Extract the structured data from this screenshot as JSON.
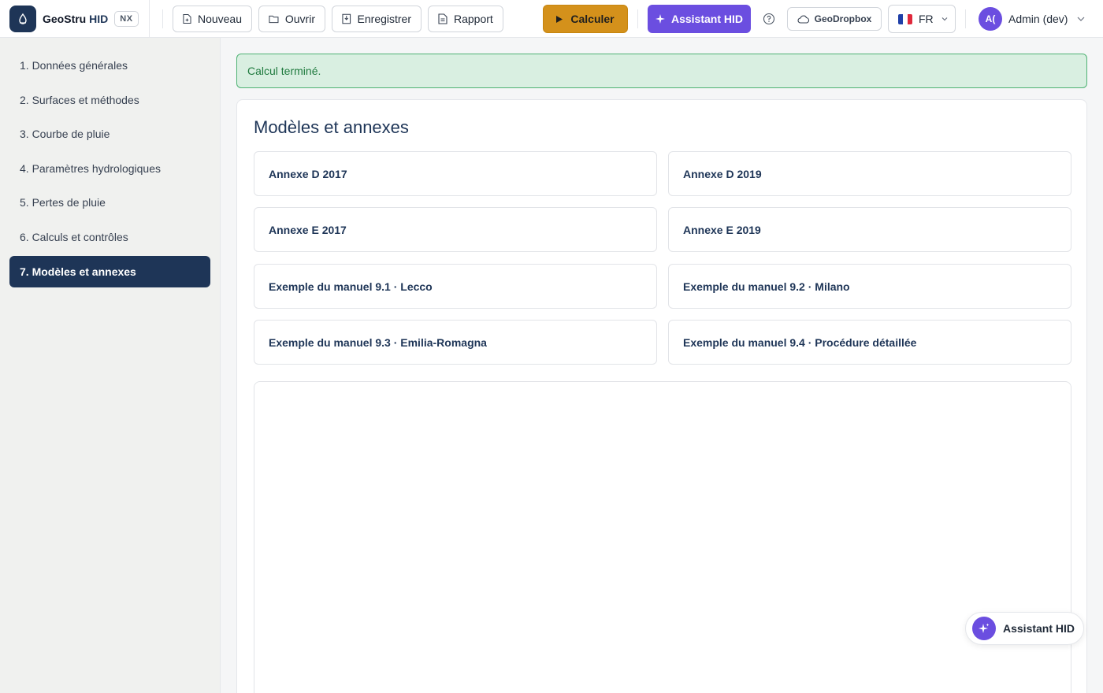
{
  "header": {
    "brand_prefix": "GeoStru",
    "brand_suffix": "HID",
    "badge": "NX",
    "toolbar": {
      "new_label": "Nouveau",
      "open_label": "Ouvrir",
      "save_label": "Enregistrer",
      "report_label": "Rapport"
    },
    "calculate_label": "Calculer",
    "assistant_label": "Assistant HID",
    "dropbox_label": "GeoDropbox",
    "language": "FR",
    "avatar_initials": "A(",
    "user_name": "Admin (dev)"
  },
  "sidebar": {
    "items": [
      {
        "label": "1. Données générales"
      },
      {
        "label": "2. Surfaces et méthodes"
      },
      {
        "label": "3. Courbe de pluie"
      },
      {
        "label": "4. Paramètres hydrologiques"
      },
      {
        "label": "5. Pertes de pluie"
      },
      {
        "label": "6. Calculs et contrôles"
      },
      {
        "label": "7. Modèles et annexes"
      }
    ],
    "active_index": 6
  },
  "alert": {
    "message": "Calcul terminé."
  },
  "main": {
    "title": "Modèles et annexes",
    "templates": [
      {
        "label": "Annexe D 2017"
      },
      {
        "label": "Annexe D 2019"
      },
      {
        "label": "Annexe E 2017"
      },
      {
        "label": "Annexe E 2019"
      },
      {
        "label": "Exemple du manuel 9.1 · Lecco"
      },
      {
        "label": "Exemple du manuel 9.2 · Milano"
      },
      {
        "label": "Exemple du manuel 9.3 · Emilia-Romagna"
      },
      {
        "label": "Exemple du manuel 9.4 · Procédure détaillée"
      }
    ]
  },
  "fab": {
    "label": "Assistant HID"
  },
  "colors": {
    "primary": "#1e3557",
    "calculate": "#d4911b",
    "assistant": "#6b4ee0",
    "success_bg": "#d9efe1",
    "success_border": "#4fb274",
    "success_text": "#1f7a3e"
  },
  "icons": {
    "brand": "droplet-icon",
    "new": "file-new-icon",
    "open": "folder-icon",
    "save": "save-icon",
    "report": "file-text-icon",
    "calculate": "play-icon",
    "assistant": "sparkle-icon",
    "help": "help-circle-icon",
    "dropbox": "cloud-icon",
    "language": "flag-fr-icon",
    "chevron": "chevron-down-icon"
  }
}
